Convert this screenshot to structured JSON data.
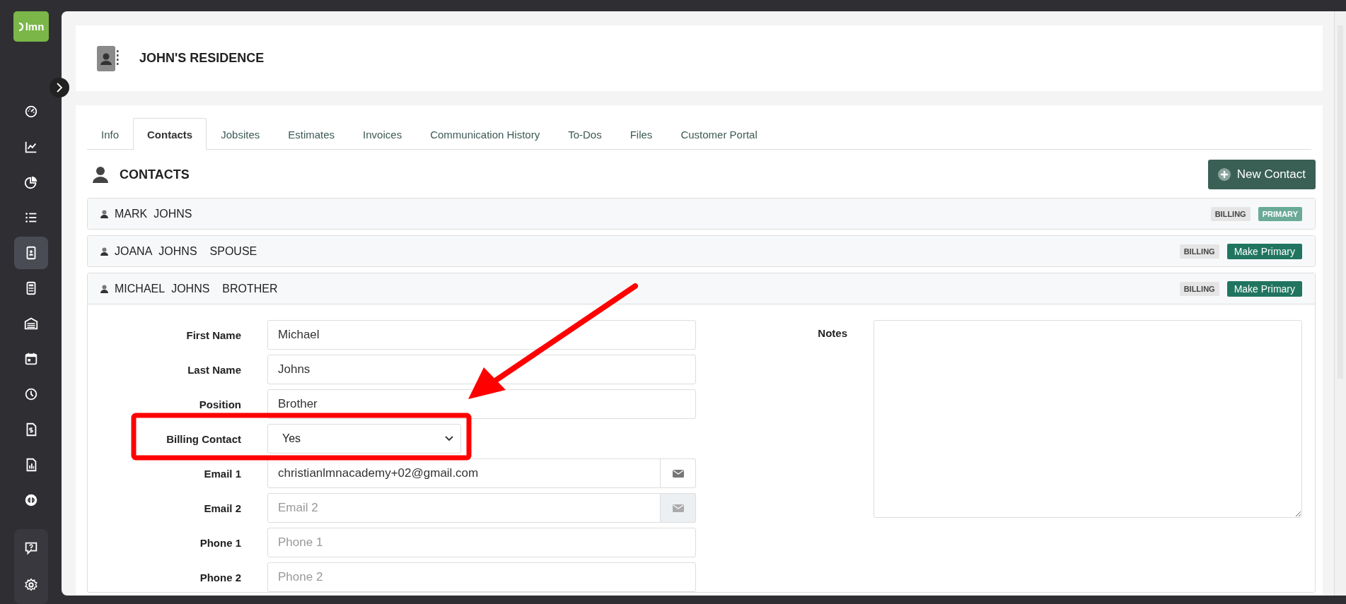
{
  "logo": {
    "text": "lmn"
  },
  "sidebar": {
    "items": [
      {
        "selected": false
      },
      {
        "selected": false
      },
      {
        "selected": false
      },
      {
        "selected": false
      },
      {
        "selected": true
      },
      {
        "selected": false
      },
      {
        "selected": false
      },
      {
        "selected": false
      },
      {
        "selected": false
      },
      {
        "selected": false
      },
      {
        "selected": false
      },
      {
        "selected": false
      }
    ]
  },
  "header": {
    "title": "JOHN'S RESIDENCE"
  },
  "tabs": [
    {
      "label": "Info",
      "selected": false
    },
    {
      "label": "Contacts",
      "selected": true
    },
    {
      "label": "Jobsites",
      "selected": false
    },
    {
      "label": "Estimates",
      "selected": false
    },
    {
      "label": "Invoices",
      "selected": false
    },
    {
      "label": "Communication History",
      "selected": false
    },
    {
      "label": "To-Dos",
      "selected": false
    },
    {
      "label": "Files",
      "selected": false
    },
    {
      "label": "Customer Portal",
      "selected": false
    }
  ],
  "section": {
    "title": "CONTACTS",
    "new_button": "New Contact"
  },
  "contacts": [
    {
      "first": "MARK",
      "last": "JOHNS",
      "billing_badge": "BILLING",
      "primary": true,
      "primary_badge": "PRIMARY",
      "expanded": false
    },
    {
      "first": "JOANA",
      "last": "JOHNS",
      "position": "SPOUSE",
      "billing_badge": "BILLING",
      "primary": false,
      "make_primary": "Make Primary",
      "expanded": false
    },
    {
      "first": "MICHAEL",
      "last": "JOHNS",
      "position": "BROTHER",
      "billing_badge": "BILLING",
      "primary": false,
      "make_primary": "Make Primary",
      "expanded": true
    }
  ],
  "form": {
    "fields": [
      {
        "kind": "text",
        "label": "First Name",
        "value": "Michael"
      },
      {
        "kind": "text",
        "label": "Last Name",
        "value": "Johns"
      },
      {
        "kind": "text",
        "label": "Position",
        "value": "Brother"
      },
      {
        "kind": "select",
        "label": "Billing Contact",
        "value": "Yes"
      },
      {
        "kind": "email",
        "label": "Email 1",
        "value": "christianlmnacademy+02@gmail.com",
        "addon_enabled": true
      },
      {
        "kind": "email",
        "label": "Email 2",
        "placeholder": "Email 2",
        "addon_enabled": false
      },
      {
        "kind": "text",
        "label": "Phone 1",
        "placeholder": "Phone 1"
      },
      {
        "kind": "text",
        "label": "Phone 2",
        "placeholder": "Phone 2"
      }
    ],
    "notes_label": "Notes"
  }
}
